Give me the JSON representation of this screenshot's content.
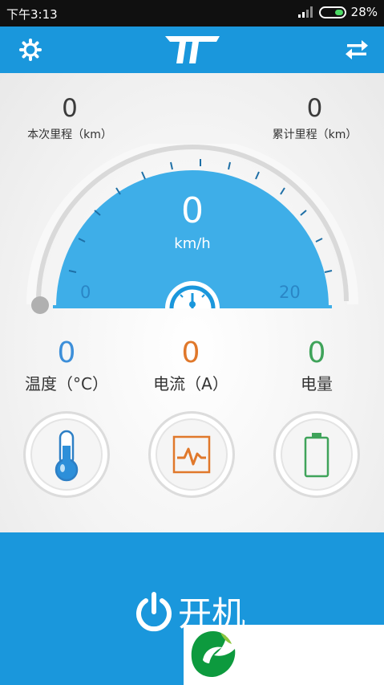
{
  "status": {
    "time": "下午3:13",
    "battery_percent": "28%"
  },
  "header": {
    "settings_icon": "gear-icon",
    "logo_icon": "brand-logo",
    "swap_icon": "swap-arrows-icon"
  },
  "stats": {
    "trip": {
      "value": "0",
      "label": "本次里程（km）"
    },
    "total": {
      "value": "0",
      "label": "累计里程（km）"
    }
  },
  "gauge": {
    "speed": "0",
    "unit": "km/h",
    "min_label": "0",
    "max_label": "20"
  },
  "metrics": {
    "temperature": {
      "value": "0",
      "label": "温度（°C）",
      "color": "#3d8fd9"
    },
    "current": {
      "value": "0",
      "label": "电流（A）",
      "color": "#e0782b"
    },
    "battery": {
      "value": "0",
      "label": "电量",
      "color": "#3fa35a"
    }
  },
  "power": {
    "label": "开机"
  },
  "colors": {
    "primary": "#1a97dc",
    "dial_blue": "#3eaee8"
  }
}
